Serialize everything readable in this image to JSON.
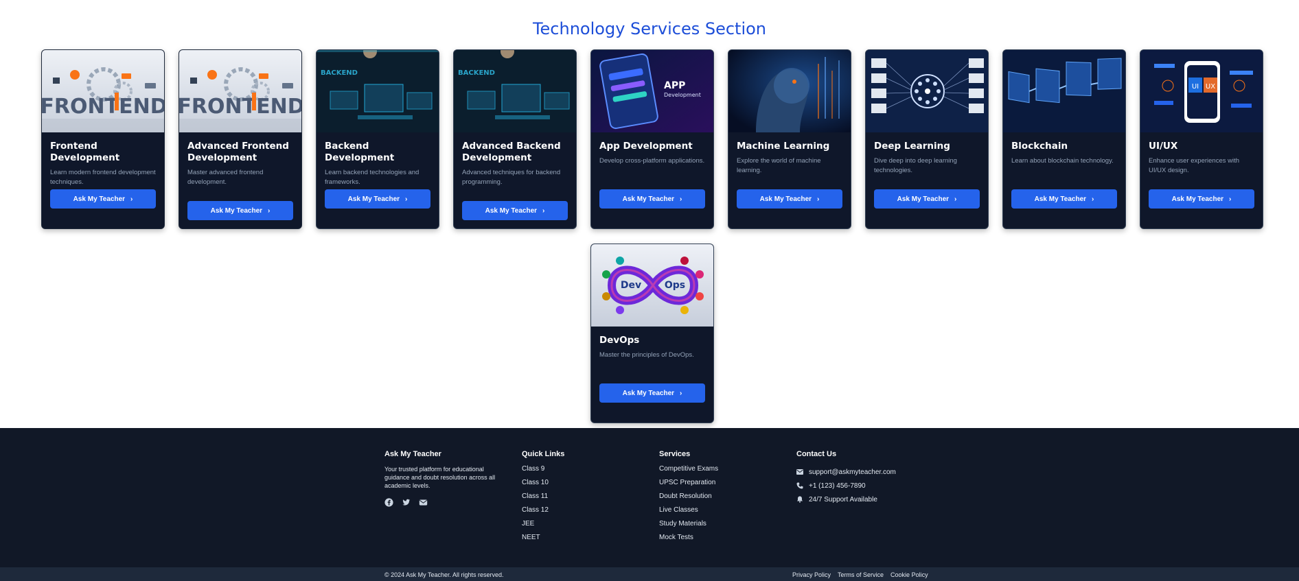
{
  "section": {
    "title": "Technology Services Section"
  },
  "cards": [
    {
      "title": "Frontend Development",
      "desc": "Learn modern frontend development techniques.",
      "button": "Ask My Teacher",
      "image_text": "FRONTEND"
    },
    {
      "title": "Advanced Frontend Development",
      "desc": "Master advanced frontend development.",
      "button": "Ask My Teacher",
      "image_text": "FRONTEND"
    },
    {
      "title": "Backend Development",
      "desc": "Learn backend technologies and frameworks.",
      "button": "Ask My Teacher",
      "image_text": "BACKEND"
    },
    {
      "title": "Advanced Backend Development",
      "desc": "Advanced techniques for backend programming.",
      "button": "Ask My Teacher",
      "image_text": "BACKEND"
    },
    {
      "title": "App Development",
      "desc": "Develop cross-platform applications.",
      "button": "Ask My Teacher",
      "image_text": "APP",
      "image_subtext": "Development"
    },
    {
      "title": "Machine Learning",
      "desc": "Explore the world of machine learning.",
      "button": "Ask My Teacher"
    },
    {
      "title": "Deep Learning",
      "desc": "Dive deep into deep learning technologies.",
      "button": "Ask My Teacher"
    },
    {
      "title": "Blockchain",
      "desc": "Learn about blockchain technology.",
      "button": "Ask My Teacher"
    },
    {
      "title": "UI/UX",
      "desc": "Enhance user experiences with UI/UX design.",
      "button": "Ask My Teacher",
      "image_text": "UI",
      "image_subtext": "UX"
    },
    {
      "title": "DevOps",
      "desc": "Master the principles of DevOps.",
      "button": "Ask My Teacher",
      "image_text": "Dev",
      "image_subtext": "Ops"
    }
  ],
  "footer": {
    "brand": {
      "title": "Ask My Teacher",
      "desc": "Your trusted platform for educational guidance and doubt resolution across all academic levels."
    },
    "social": [
      "facebook-icon",
      "twitter-icon",
      "email-icon"
    ],
    "quick_links": {
      "title": "Quick Links",
      "items": [
        "Class 9",
        "Class 10",
        "Class 11",
        "Class 12",
        "JEE",
        "NEET"
      ]
    },
    "services": {
      "title": "Services",
      "items": [
        "Competitive Exams",
        "UPSC Preparation",
        "Doubt Resolution",
        "Live Classes",
        "Study Materials",
        "Mock Tests"
      ]
    },
    "contact": {
      "title": "Contact Us",
      "email": "support@askmyteacher.com",
      "phone": "+1 (123) 456-7890",
      "support": "24/7 Support Available"
    },
    "copyright": "© 2024 Ask My Teacher. All rights reserved.",
    "legal": [
      "Privacy Policy",
      "Terms of Service",
      "Cookie Policy"
    ]
  },
  "colors": {
    "accent": "#2563eb",
    "title": "#1d4ed8",
    "card_bg": "#0f172a",
    "footer_bg": "#111827"
  }
}
